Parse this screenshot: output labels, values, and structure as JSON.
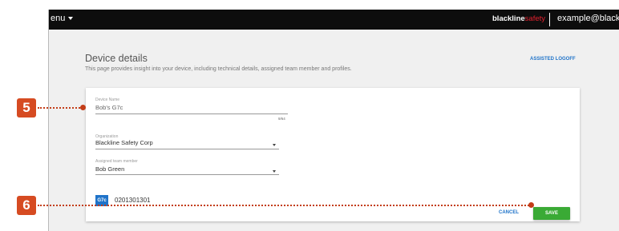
{
  "topbar": {
    "menu_label": "enu",
    "brand": {
      "primary": "blackline",
      "secondary": "safety"
    },
    "user_email": "example@blacklin"
  },
  "page": {
    "title": "Device details",
    "description": "This page provides insight into your device, including technical details, assigned team member and profiles.",
    "assisted_logoff_label": "ASSISTED LOGOFF"
  },
  "form": {
    "device_name": {
      "label": "Device Name",
      "value": "Bob's G7c",
      "counter": "9/64"
    },
    "organization": {
      "label": "Organization",
      "value": "Blackline Safety Corp"
    },
    "assigned_team_member": {
      "label": "Assigned team member",
      "value": "Bob Green"
    },
    "device": {
      "badge": "G7c",
      "serial": "0201301301"
    }
  },
  "actions": {
    "cancel_label": "CANCEL",
    "save_label": "SAVE"
  },
  "callouts": [
    {
      "number": "5"
    },
    {
      "number": "6"
    }
  ],
  "colors": {
    "topbar": "#0d0d0d",
    "accent": "#1f73c9",
    "save": "#3aaa35",
    "brand_red": "#e4202e",
    "callout": "#d64b22"
  }
}
